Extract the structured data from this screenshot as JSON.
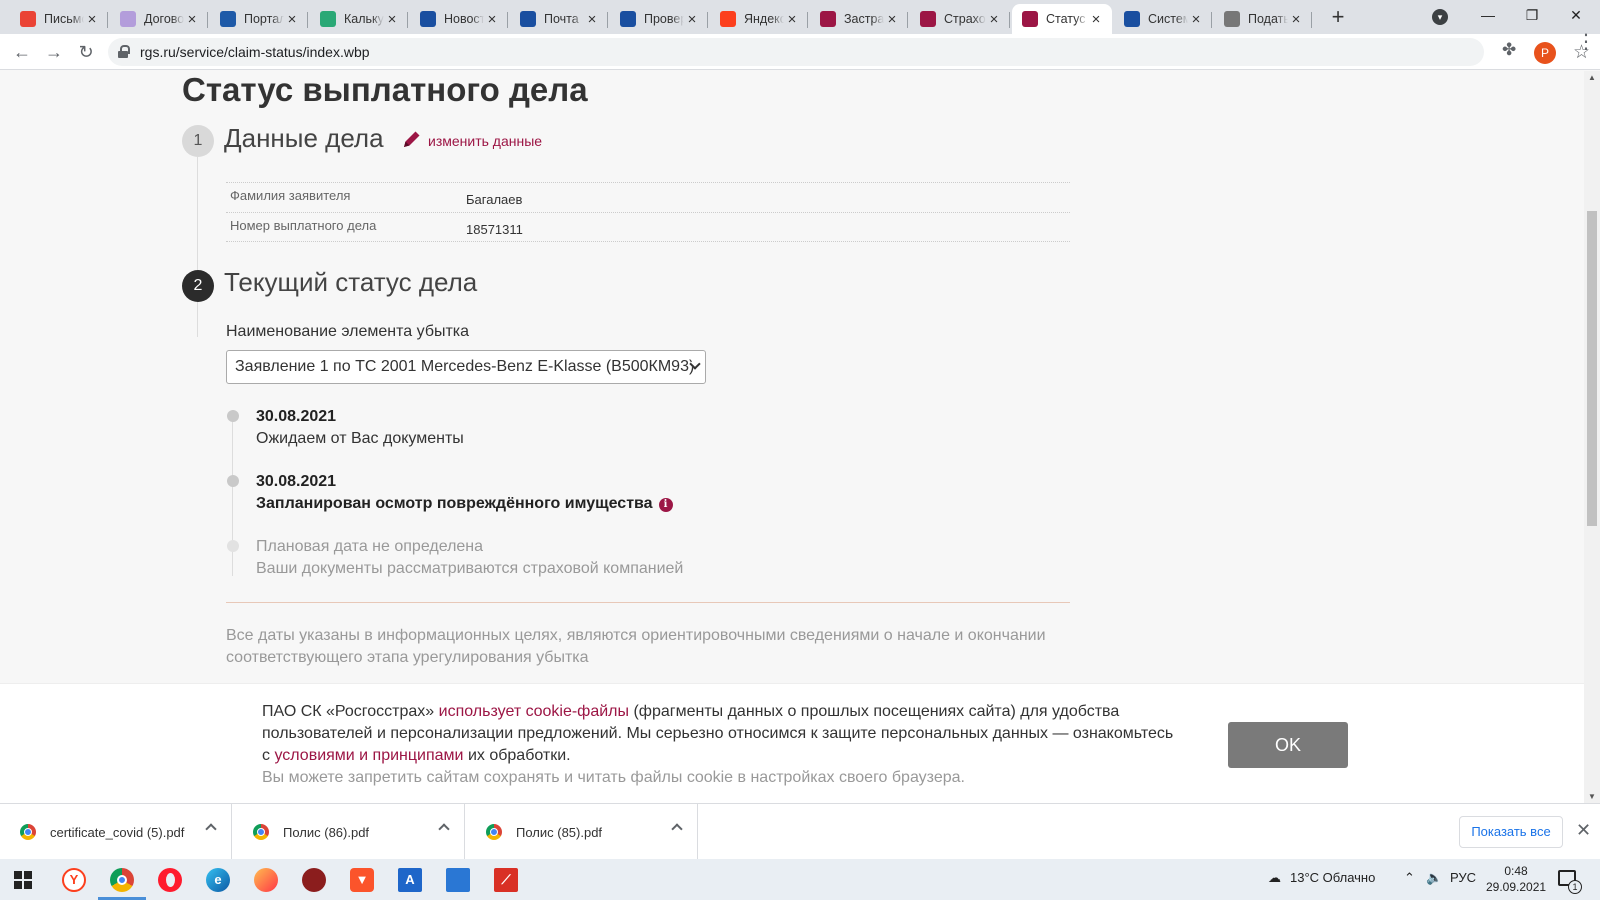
{
  "browser": {
    "tabs": [
      {
        "title": "Письмо",
        "favicon": "gmail-icon",
        "color": "#ea4335"
      },
      {
        "title": "Договор",
        "favicon": "pen-icon",
        "color": "#b39ddb"
      },
      {
        "title": "Портал",
        "favicon": "flag-icon",
        "color": "#1e5aa8"
      },
      {
        "title": "Калькулятор",
        "favicon": "calc-icon",
        "color": "#2aa876"
      },
      {
        "title": "Новости",
        "favicon": "news-icon",
        "color": "#1a4fa0"
      },
      {
        "title": "Почта",
        "favicon": "mail-icon",
        "color": "#1a4fa0"
      },
      {
        "title": "Проверка",
        "favicon": "mail-icon",
        "color": "#1a4fa0"
      },
      {
        "title": "Яндекс",
        "favicon": "yandex-icon",
        "color": "#fc3f1d"
      },
      {
        "title": "Застрахованные",
        "favicon": "rgs-icon",
        "color": "#9c1645"
      },
      {
        "title": "Страховые",
        "favicon": "rgs-icon",
        "color": "#9c1645"
      },
      {
        "title": "Статус",
        "favicon": "rgs-icon",
        "color": "#9c1645"
      },
      {
        "title": "Система",
        "favicon": "car-icon",
        "color": "#1a4fa0"
      },
      {
        "title": "Подать",
        "favicon": "emblem-icon",
        "color": "#777777"
      }
    ],
    "url": "rgs.ru/service/claim-status/index.wbp",
    "profile_initial": "Р"
  },
  "page": {
    "title": "Статус выплатного дела",
    "step1": {
      "number": "1",
      "title": "Данные дела",
      "edit_link": "изменить данные",
      "rows": [
        {
          "label": "Фамилия заявителя",
          "value": "Багалаев"
        },
        {
          "label": "Номер выплатного дела",
          "value": "18571311"
        }
      ]
    },
    "step2": {
      "number": "2",
      "title": "Текущий статус дела",
      "select_label": "Наименование элемента убытка",
      "select_value": "Заявление 1 по ТС 2001 Mercedes-Benz E-Klasse (В500КМ93)"
    },
    "timeline": [
      {
        "date": "30.08.2021",
        "text": "Ожидаем от Вас документы"
      },
      {
        "date": "30.08.2021",
        "text": "Запланирован осмотр повреждённого имущества"
      }
    ],
    "pending": {
      "line1": "Плановая дата не определена",
      "line2": "Ваши документы рассматриваются страховой компанией"
    },
    "disclaimer": "Все даты указаны в информационных целях, являются ориентировочными сведениями о начале и окончании соответствующего этапа урегулирования убытка"
  },
  "cookie": {
    "part1": "ПАО СК «Росгосстрах» ",
    "link1": "использует cookie-файлы",
    "part2": " (фрагменты данных о прошлых посещениях сайта) для удобства пользователей и персонализации предложений. Мы серьезно относимся к защите персональных данных — ознакомьтесь с ",
    "link2": "условиями и принципами",
    "part3": " их обработки.",
    "sub": "Вы можете запретить сайтам сохранять и читать файлы cookie в настройках своего браузера.",
    "ok": "OK"
  },
  "downloads": {
    "items": [
      "certificate_covid (5).pdf",
      "Полис (86).pdf",
      "Полис (85).pdf"
    ],
    "show_all": "Показать все"
  },
  "taskbar": {
    "weather": "13°C  Облачно",
    "lang": "РУС",
    "time": "0:48",
    "date": "29.09.2021",
    "notifications": "1"
  },
  "colors": {
    "brand": "#9c1645",
    "accent": "#1a73e8"
  }
}
